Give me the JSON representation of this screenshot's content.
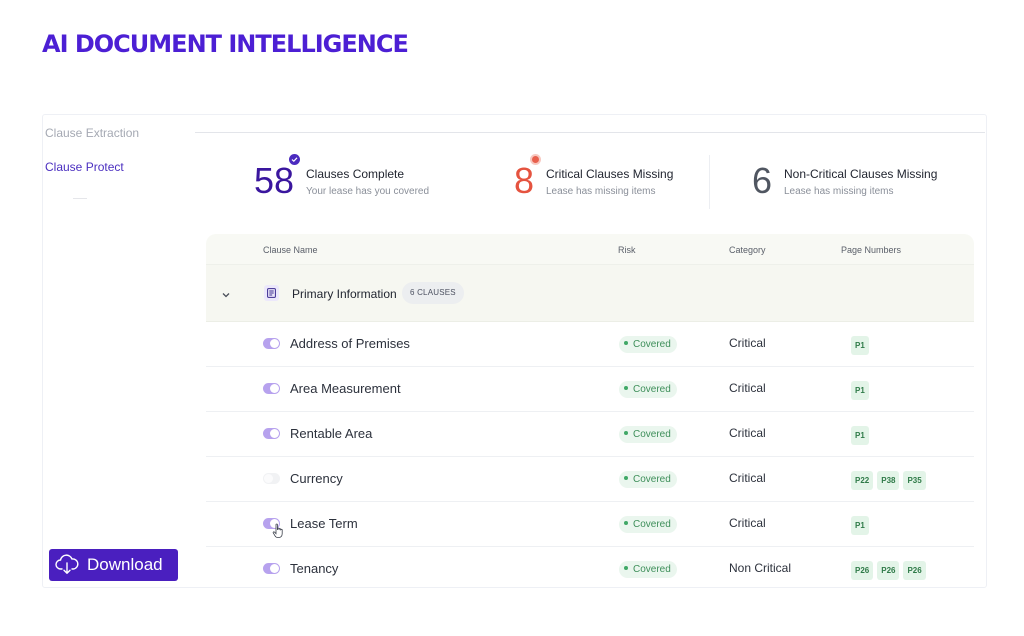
{
  "header": {
    "title": "AI DOCUMENT INTELLIGENCE"
  },
  "sidebar": {
    "items": [
      {
        "label": "Clause Extraction"
      },
      {
        "label": "Clause Protect"
      }
    ],
    "download_label": "Download"
  },
  "stats": [
    {
      "value": "58",
      "title": "Clauses Complete",
      "subtitle": "Your lease has you covered"
    },
    {
      "value": "8",
      "title": "Critical Clauses Missing",
      "subtitle": "Lease has missing items"
    },
    {
      "value": "6",
      "title": "Non-Critical Clauses Missing",
      "subtitle": "Lease has missing items"
    }
  ],
  "table": {
    "columns": [
      "Clause Name",
      "Risk",
      "Category",
      "Page Numbers"
    ],
    "group": {
      "title": "Primary Information",
      "badge": "6 CLAUSES"
    },
    "rows": [
      {
        "name": "Address of Premises",
        "enabled": true,
        "risk": "Covered",
        "category": "Critical",
        "pages": [
          "P1"
        ]
      },
      {
        "name": "Area Measurement",
        "enabled": true,
        "risk": "Covered",
        "category": "Critical",
        "pages": [
          "P1"
        ]
      },
      {
        "name": "Rentable Area",
        "enabled": true,
        "risk": "Covered",
        "category": "Critical",
        "pages": [
          "P1"
        ]
      },
      {
        "name": "Currency",
        "enabled": false,
        "risk": "Covered",
        "category": "Critical",
        "pages": [
          "P22",
          "P38",
          "P35"
        ]
      },
      {
        "name": "Lease Term",
        "enabled": true,
        "risk": "Covered",
        "category": "Critical",
        "pages": [
          "P1"
        ]
      },
      {
        "name": "Tenancy",
        "enabled": true,
        "risk": "Covered",
        "category": "Non Critical",
        "pages": [
          "P26",
          "P26",
          "P26"
        ]
      }
    ]
  },
  "colors": {
    "brand": "#4a1fbf",
    "critical": "#e5533f",
    "covered": "#3e8f5a"
  }
}
